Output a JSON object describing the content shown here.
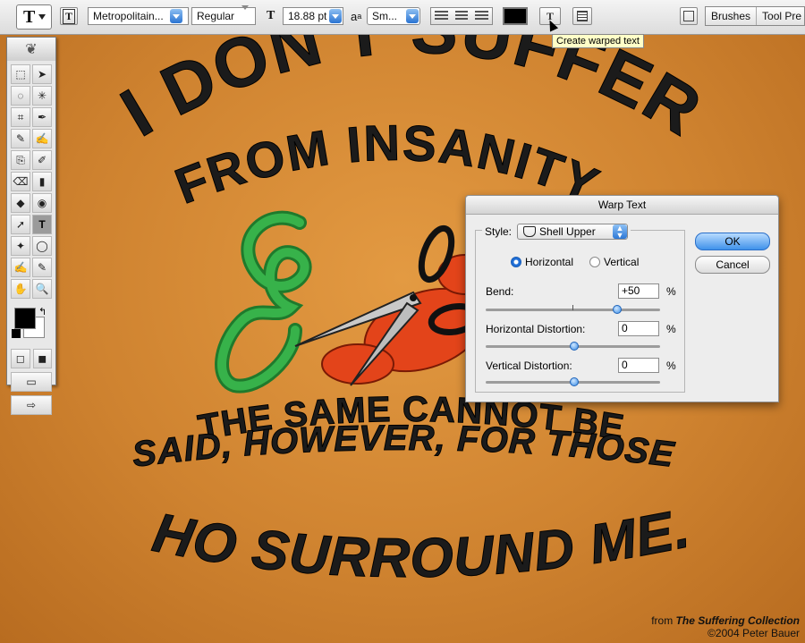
{
  "options_bar": {
    "tool_glyph": "T",
    "font_family": "Metropolitain...",
    "font_style": "Regular",
    "font_size": "18.88 pt",
    "aa_label": "a",
    "aa_sub": "a",
    "aa_value": "Sm...",
    "text_color": "#000000",
    "tooltip": "Create warped text",
    "palette_tabs": [
      "Brushes",
      "Tool Pre"
    ]
  },
  "canvas": {
    "headline_line1": "I DON'T SUFFER",
    "headline_line2": "FROM INSANITY",
    "body_line1": "THE SAME CANNOT BE",
    "body_line2": "SAID, HOWEVER, FOR THOSE",
    "body_line3": "WHO SURROUND ME...",
    "credit_prefix": "from ",
    "credit_title": "The Suffering Collection",
    "credit_copyright": "©2004 Peter Bauer"
  },
  "toolbox": {
    "tools": [
      "⬚",
      "➤",
      "◌",
      "✳",
      "⌗",
      "✒",
      "✎",
      "✍",
      "⎘",
      "✐",
      "⌫",
      "▮",
      "◆",
      "◉",
      "➚",
      "T",
      "✦",
      "◯",
      "✍",
      "✎",
      "✋",
      "🔍"
    ]
  },
  "warp_dialog": {
    "title": "Warp Text",
    "style_label": "Style:",
    "style_value": "Shell Upper",
    "orientation": {
      "horizontal": "Horizontal",
      "vertical": "Vertical",
      "selected": "horizontal"
    },
    "bend": {
      "label": "Bend:",
      "value": "+50",
      "unit": "%",
      "percent": 50
    },
    "horizontal_distortion": {
      "label": "Horizontal Distortion:",
      "value": "0",
      "unit": "%",
      "percent": 0
    },
    "vertical_distortion": {
      "label": "Vertical Distortion:",
      "value": "0",
      "unit": "%",
      "percent": 0
    },
    "ok_label": "OK",
    "cancel_label": "Cancel"
  },
  "colors": {
    "canvas_orange": "#d88a34",
    "text_dark": "#1b1b1b",
    "green": "#2e9b3e",
    "red": "#e3441a",
    "accent_blue": "#3f92ea"
  }
}
